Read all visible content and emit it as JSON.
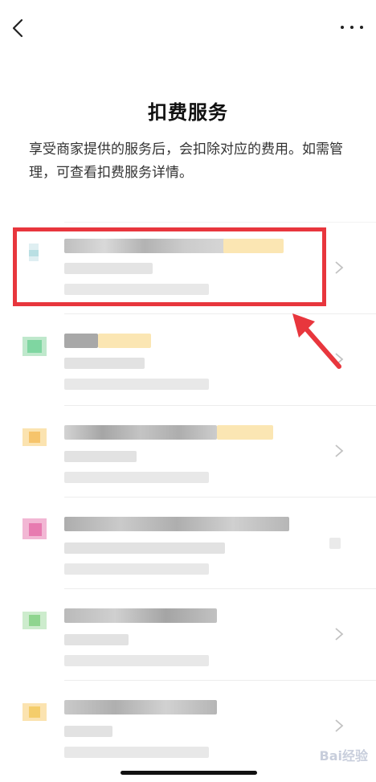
{
  "header": {
    "back_icon": "chevron-left-icon",
    "more_icon": "more-horizontal-icon"
  },
  "page": {
    "title": "扣费服务",
    "description": "享受商家提供的服务后，会扣除对应的费用。如需管理，可查看扣费服务详情。"
  },
  "services": [
    {
      "logo_color": "#b9dfe3",
      "accent": "#fbe6b3"
    },
    {
      "logo_color": "#7fd6a1",
      "accent": "#fbe6b3"
    },
    {
      "logo_color": "#f6c46b",
      "accent": "#fbe6b3"
    },
    {
      "logo_color": "#e77bb0",
      "accent": "#cfcfcf"
    },
    {
      "logo_color": "#8fd58f",
      "accent": "#cfcfcf"
    },
    {
      "logo_color": "#f4cd6b",
      "accent": "#cfcfcf"
    }
  ],
  "annotation": {
    "color": "#e8363d"
  },
  "watermark": {
    "text": "Bai经验"
  }
}
